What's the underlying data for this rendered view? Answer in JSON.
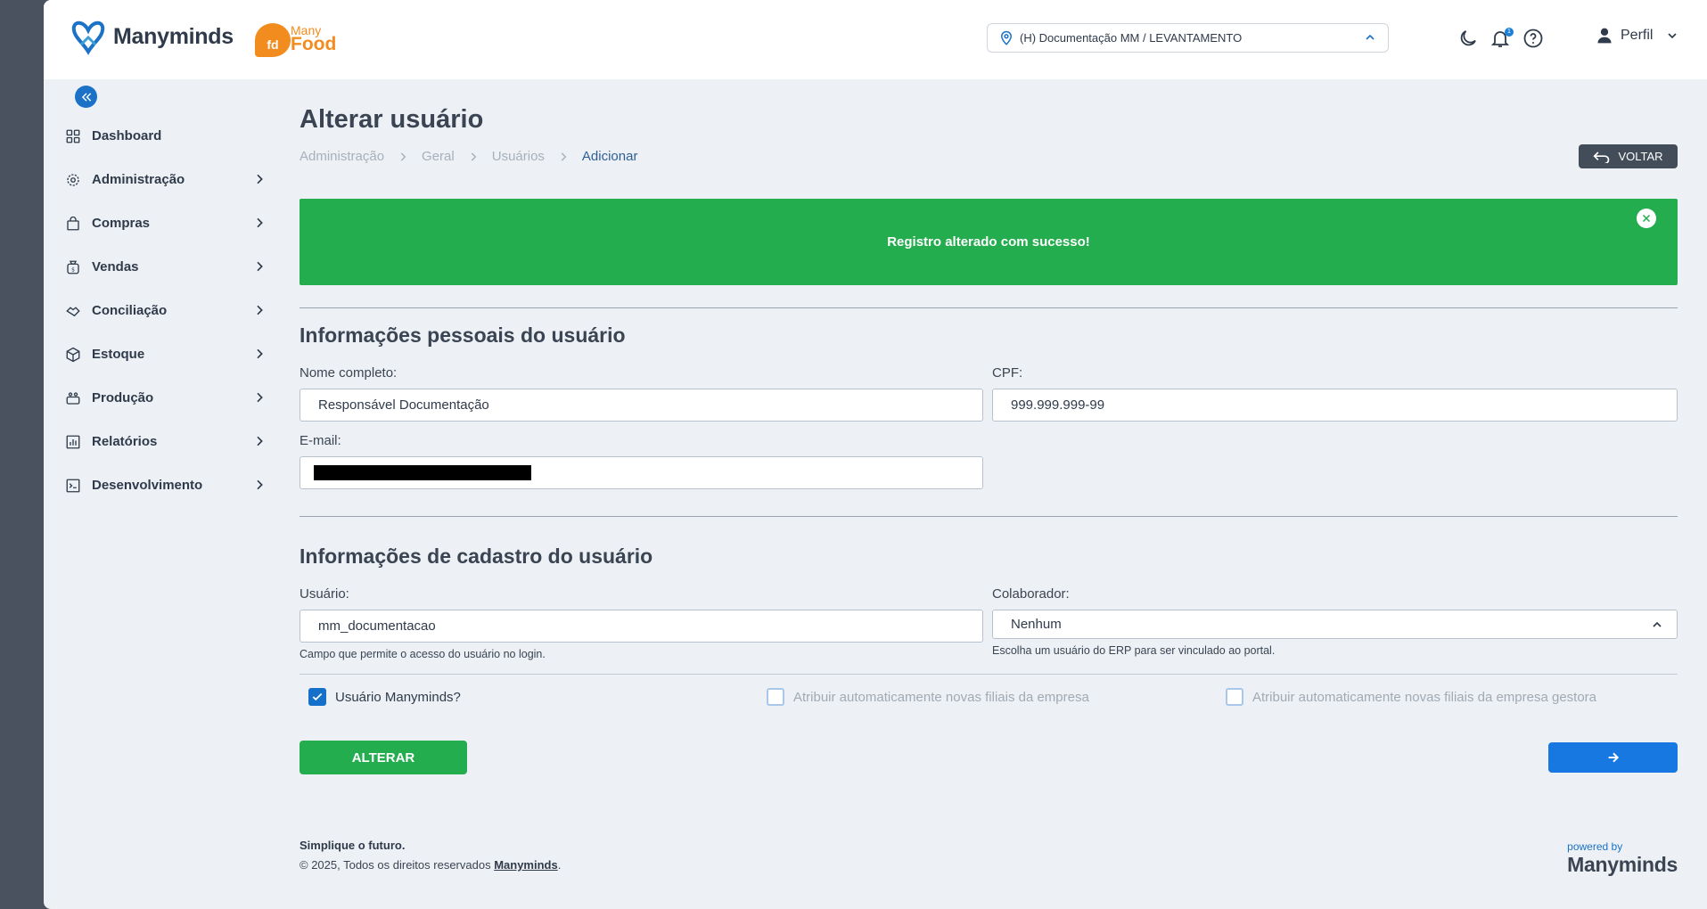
{
  "brand": {
    "name": "Manyminds",
    "food_small": "Many",
    "food_word": "Food",
    "food_badge": "fd"
  },
  "header": {
    "location": "(H) Documentação MM / LEVANTAMENTO",
    "notification_count": "1",
    "profile_label": "Perfil"
  },
  "sidebar": {
    "items": [
      {
        "label": "Dashboard",
        "icon": "grid-icon",
        "has_arrow": false
      },
      {
        "label": "Administração",
        "icon": "gear-icon",
        "has_arrow": true
      },
      {
        "label": "Compras",
        "icon": "shopping-bag-icon",
        "has_arrow": true
      },
      {
        "label": "Vendas",
        "icon": "money-bag-icon",
        "has_arrow": true
      },
      {
        "label": "Conciliação",
        "icon": "handshake-icon",
        "has_arrow": true
      },
      {
        "label": "Estoque",
        "icon": "box-icon",
        "has_arrow": true
      },
      {
        "label": "Produção",
        "icon": "factory-icon",
        "has_arrow": true
      },
      {
        "label": "Relatórios",
        "icon": "bar-chart-icon",
        "has_arrow": true
      },
      {
        "label": "Desenvolvimento",
        "icon": "terminal-icon",
        "has_arrow": true
      }
    ]
  },
  "page": {
    "title": "Alterar usuário",
    "breadcrumb": [
      "Administração",
      "Geral",
      "Usuários",
      "Adicionar"
    ],
    "back_label": "VOLTAR"
  },
  "alert": {
    "message": "Registro alterado com sucesso!"
  },
  "personal": {
    "section_title": "Informações pessoais do usuário",
    "name_label": "Nome completo:",
    "name_value": "Responsável Documentação",
    "cpf_label": "CPF:",
    "cpf_value": "999.999.999-99",
    "email_label": "E-mail:"
  },
  "registration": {
    "section_title": "Informações de cadastro do usuário",
    "user_label": "Usuário:",
    "user_value": "mm_documentacao",
    "user_help": "Campo que permite o acesso do usuário no login.",
    "collab_label": "Colaborador:",
    "collab_value": "Nenhum",
    "collab_help": "Escolha um usuário do ERP para ser vinculado ao portal."
  },
  "checkboxes": [
    {
      "label": "Usuário Manyminds?",
      "checked": true,
      "disabled": false
    },
    {
      "label": "Atribuir automaticamente novas filiais da empresa",
      "checked": false,
      "disabled": true
    },
    {
      "label": "Atribuir automaticamente novas filiais da empresa gestora",
      "checked": false,
      "disabled": true
    }
  ],
  "actions": {
    "submit_label": "ALTERAR"
  },
  "footer": {
    "tagline": "Simplique o futuro.",
    "copyright": "© 2025, Todos os direitos reservados",
    "company_link": "Manyminds",
    "period": ".",
    "powered_by": "powered by",
    "powered_brand": "Manyminds"
  },
  "colors": {
    "accent": "#1b72c6",
    "success": "#23ad4e",
    "sidebar_bg": "#4a5260",
    "page_bg": "#edf1f5"
  }
}
